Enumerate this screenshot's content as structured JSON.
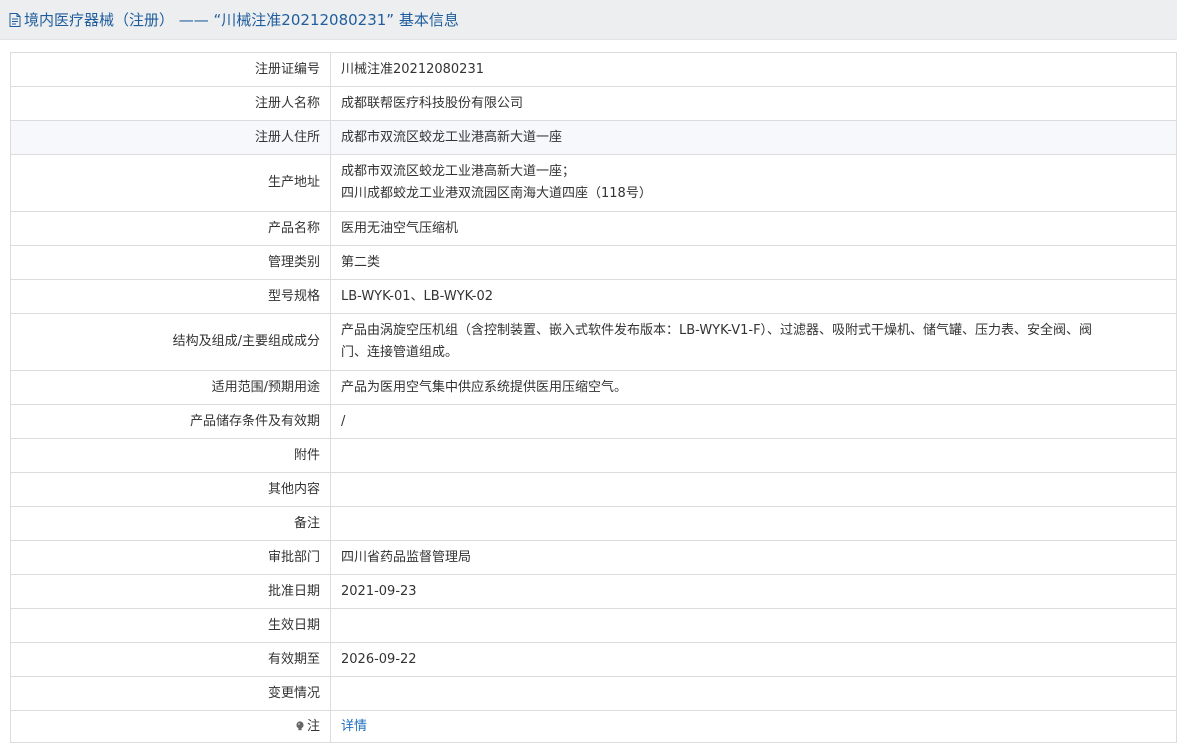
{
  "page": {
    "title": "境内医疗器械（注册） —— “川械注准20212080231” 基本信息"
  },
  "rows": [
    {
      "label": "注册证编号",
      "value": "川械注准20212080231"
    },
    {
      "label": "注册人名称",
      "value": "成都联帮医疗科技股份有限公司"
    },
    {
      "label": "注册人住所",
      "value": "成都市双流区蛟龙工业港高新大道一座"
    },
    {
      "label": "生产地址",
      "lines": [
        "成都市双流区蛟龙工业港高新大道一座；",
        "四川成都蛟龙工业港双流园区南海大道四座（118号）"
      ]
    },
    {
      "label": "产品名称",
      "value": "医用无油空气压缩机"
    },
    {
      "label": "管理类别",
      "value": "第二类"
    },
    {
      "label": "型号规格",
      "value": "LB-WYK-01、LB-WYK-02"
    },
    {
      "label": "结构及组成/主要组成成分",
      "lines": [
        "产品由涡旋空压机组（含控制装置、嵌入式软件发布版本：LB-WYK-V1-F）、过滤器、吸附式干燥机、储气罐、压力表、安全阀、阀",
        "门、连接管道组成。"
      ]
    },
    {
      "label": "适用范围/预期用途",
      "value": "产品为医用空气集中供应系统提供医用压缩空气。"
    },
    {
      "label": "产品储存条件及有效期",
      "value": "/"
    },
    {
      "label": "附件",
      "value": ""
    },
    {
      "label": "其他内容",
      "value": ""
    },
    {
      "label": "备注",
      "value": ""
    },
    {
      "label": "审批部门",
      "value": "四川省药品监督管理局"
    },
    {
      "label": "批准日期",
      "value": "2021-09-23"
    },
    {
      "label": "生效日期",
      "value": ""
    },
    {
      "label": "有效期至",
      "value": "2026-09-22"
    },
    {
      "label": "变更情况",
      "value": ""
    },
    {
      "label": "注",
      "value": "详情"
    }
  ],
  "colors": {
    "title_text": "#1f5d9c",
    "title_bg": "#eceef0",
    "link": "#1f6fbf",
    "border": "#dcdcdc"
  },
  "icons": {
    "title": "document-icon",
    "note": "bulb-icon"
  }
}
